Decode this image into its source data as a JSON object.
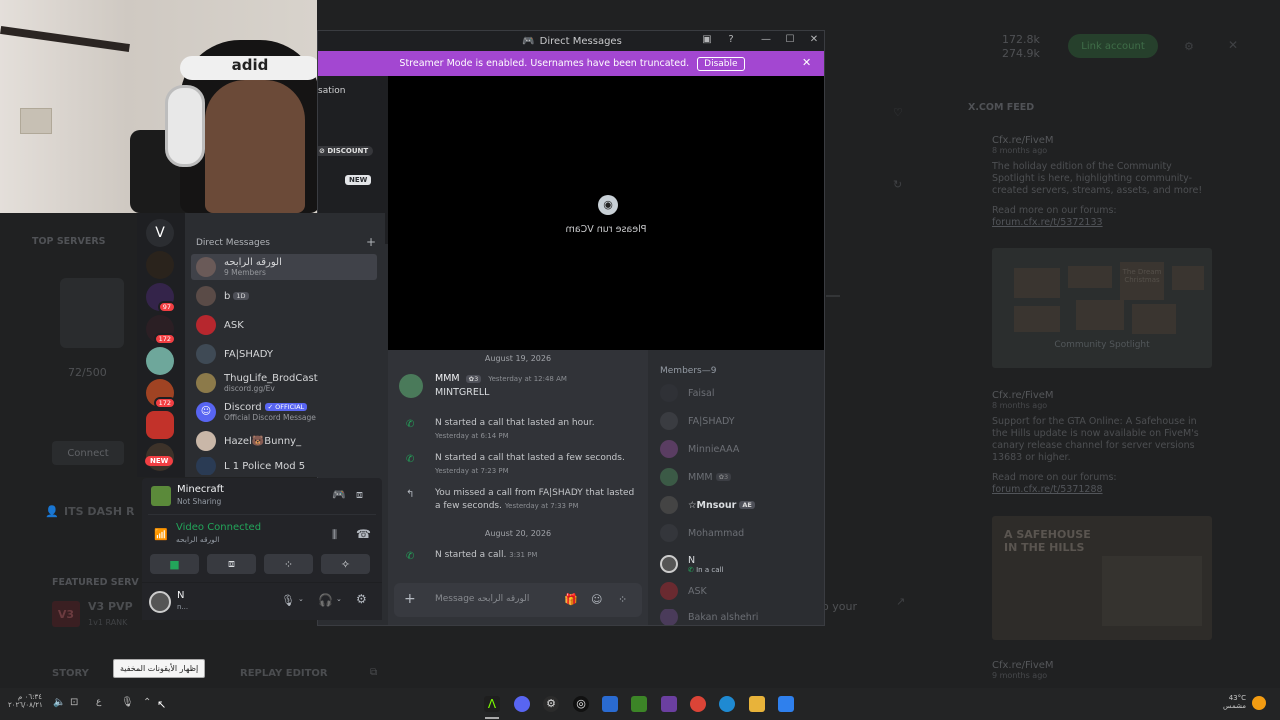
{
  "launcher": {
    "stats": [
      "172.8k",
      "274.9k"
    ],
    "link_account": "Link account",
    "top_servers": "TOP SERVERS",
    "server_count": "72/500",
    "connect": "Connect",
    "its_dash": "ITS DASH R",
    "featured": "FEATURED SERV",
    "v3_title": "V3 PVP",
    "v3_sub": "1v1 RANK",
    "story": "STORY",
    "replay_editor": "REPLAY EDITOR",
    "your_text": "o your",
    "feed_header": "X.COM FEED",
    "feed": [
      {
        "title": "Cfx.re/FiveM",
        "sub": "8 months ago",
        "body": "The holiday edition of the Community Spotlight is here, highlighting community-created servers, streams, assets, and more!",
        "more": "Read more on our forums:",
        "link": "forum.cfx.re/t/5372133"
      },
      {
        "title": "Cfx.re/FiveM",
        "sub": "8 months ago",
        "body": "Support for the GTA Online: A Safehouse in the Hills update is now available on FiveM's canary release channel for server versions 13683 or higher.",
        "more": "Read more on our forums:",
        "link": "forum.cfx.re/t/5371288"
      },
      {
        "title": "Cfx.re/FiveM",
        "sub": "9 months ago"
      }
    ],
    "img1_caption": "Community Spotlight",
    "img1_badge": "The Dream Christmas",
    "img2_caption": "A SAFEHOUSE IN THE HILLS"
  },
  "window": {
    "title": "Direct Messages",
    "streamer_text": "Streamer Mode is enabled. Usernames have been truncated.",
    "disable": "Disable",
    "conversation_stub": "sation",
    "discount": "DISCOUNT",
    "new": "NEW",
    "webcam_msg": "Please run VCam"
  },
  "dm_panel": {
    "header": "Direct Messages",
    "items": [
      {
        "name": "الورقه الرابحه",
        "sub": "9 Members"
      },
      {
        "name": "b",
        "tag": "1D"
      },
      {
        "name": "ASK"
      },
      {
        "name": "FA|SHADY"
      },
      {
        "name": "ThugLife_BrodCast",
        "sub": "discord.gg/Ev"
      },
      {
        "name": "Discord",
        "tag": "✓ OFFICIAL",
        "sub": "Official Discord Message"
      },
      {
        "name": "Hazel🐻Bunny_"
      },
      {
        "name": "L 1 Police Mod 5"
      }
    ],
    "guild_badges": [
      "97",
      "172",
      "172",
      "NEW"
    ]
  },
  "activity": {
    "game": "Minecraft",
    "game_status": "Not Sharing"
  },
  "voice": {
    "status": "Video Connected",
    "channel": "الورقه الرابحه"
  },
  "user": {
    "name": "N",
    "status": "n..."
  },
  "chat": {
    "date1": "August 19, 2026",
    "author": "MMM",
    "author_tag": "✿3",
    "author_time": "Yesterday at 12:48 AM",
    "author_msg": "MINTGRELL",
    "calls": [
      {
        "text": "N started a call that lasted an hour.",
        "time": "Yesterday at 6:14 PM"
      },
      {
        "text": "N started a call that lasted a few seconds.",
        "time": "Yesterday at 7:23 PM"
      },
      {
        "text": "You missed a call from FA|SHADY that lasted a few seconds.",
        "time": "Yesterday at 7:33 PM"
      }
    ],
    "date2": "August 20, 2026",
    "last_call": "N started a call.",
    "last_time": "3:31 PM",
    "input_placeholder": "Message الورقه الرابحه"
  },
  "members": {
    "header": "Members—9",
    "list": [
      {
        "name": "Faisal"
      },
      {
        "name": "FA|SHADY"
      },
      {
        "name": "MinnieAAA"
      },
      {
        "name": "MMM",
        "tag": "✿3"
      },
      {
        "name": "☆Mnsour",
        "tag": "AE",
        "bright": true
      },
      {
        "name": "Mohammad"
      },
      {
        "name": "N",
        "sub": "In a call",
        "bright": true
      },
      {
        "name": "ASK"
      },
      {
        "name": "Bakan alshehri"
      }
    ]
  },
  "taskbar": {
    "time": "٠٦:٣٤ م",
    "date": "٢٠٢٦/٠٨/٢١",
    "weather": "43°C",
    "weather_sub": "مشمس",
    "tooltip": "إظهار الأيقونات المخفية"
  },
  "colors": {
    "accent": "#a347d1",
    "green": "#23a55a",
    "blurple": "#5865f2",
    "red": "#f23f43"
  }
}
